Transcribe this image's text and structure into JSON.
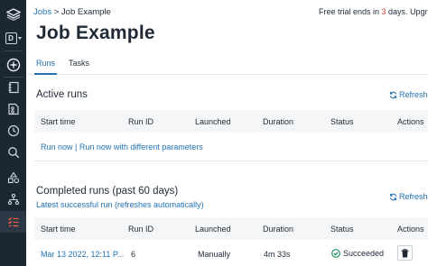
{
  "breadcrumb": {
    "parent": "Jobs",
    "separator": ">",
    "current": "Job Example"
  },
  "trial": {
    "prefix": "Free trial ends in ",
    "days": "3",
    "suffix": " days. Upgrade"
  },
  "page_title": "Job Example",
  "tabs": [
    {
      "label": "Runs",
      "active": true
    },
    {
      "label": "Tasks",
      "active": false
    }
  ],
  "active_runs": {
    "title": "Active runs",
    "refresh_label": "Refresh",
    "columns": [
      "Start time",
      "Run ID",
      "Launched",
      "Duration",
      "Status",
      "Actions"
    ],
    "run_now_label": "Run now",
    "separator": "|",
    "run_params_label": "Run now with different parameters"
  },
  "completed_runs": {
    "title": "Completed runs (past 60 days)",
    "subtitle": "Latest successful run (refreshes automatically)",
    "refresh_label": "Refresh",
    "columns": [
      "Start time",
      "Run ID",
      "Launched",
      "Duration",
      "Status",
      "Actions"
    ],
    "rows": [
      {
        "start_time": "Mar 13 2022, 12:11 P...",
        "run_id": "6",
        "launched": "Manually",
        "duration": "4m 33s",
        "status": "Succeeded"
      }
    ]
  },
  "sidebar": {
    "workspace_letter": "D",
    "icons": [
      "stack-logo-icon",
      "workspace-switcher",
      "create-plus-icon",
      "notebook-icon",
      "repos-icon",
      "history-icon",
      "search-icon",
      "shapes-icon",
      "compute-icon",
      "jobs-icon"
    ]
  },
  "colors": {
    "sidebar": "#1b2733",
    "accent": "#2272b4",
    "success": "#1b8a5a",
    "warning": "#e03c31"
  }
}
